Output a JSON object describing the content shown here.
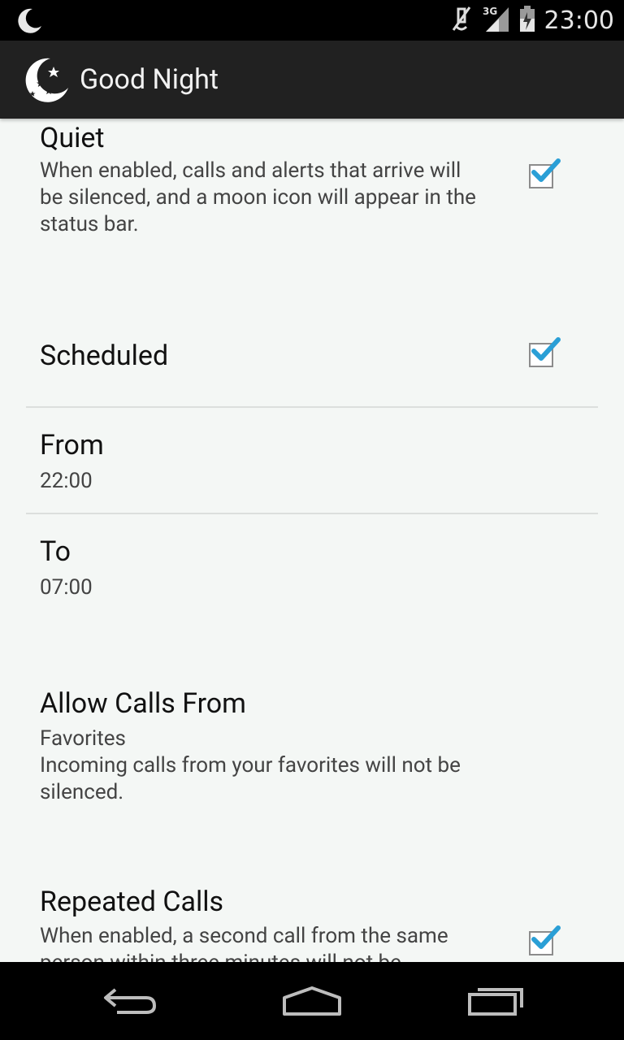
{
  "status_bar": {
    "time": "23:00",
    "network": "3G",
    "icons": [
      "moon-icon",
      "mute-icon",
      "signal-icon",
      "battery-icon"
    ]
  },
  "action_bar": {
    "title": "Good Night",
    "icon": "moon-stars-icon"
  },
  "preferences": [
    {
      "title": "Quiet",
      "summary": "When enabled, calls and alerts that arrive will be silenced, and a moon icon will appear in the status bar.",
      "checked": true
    },
    {
      "title": "Scheduled",
      "checked": true
    },
    {
      "title": "From",
      "summary": "22:00"
    },
    {
      "title": "To",
      "summary": "07:00"
    },
    {
      "title": "Allow Calls From",
      "summary_line1": "Favorites",
      "summary": "Incoming calls from your favorites will not be silenced."
    },
    {
      "title": "Repeated Calls",
      "summary": "When enabled, a second call from the same person within three minutes will not be",
      "checked": true
    }
  ],
  "colors": {
    "accent": "#2a9fd6",
    "background": "#f4f7f5",
    "actionbar": "#212121"
  },
  "nav": [
    "back-icon",
    "home-icon",
    "recents-icon"
  ]
}
